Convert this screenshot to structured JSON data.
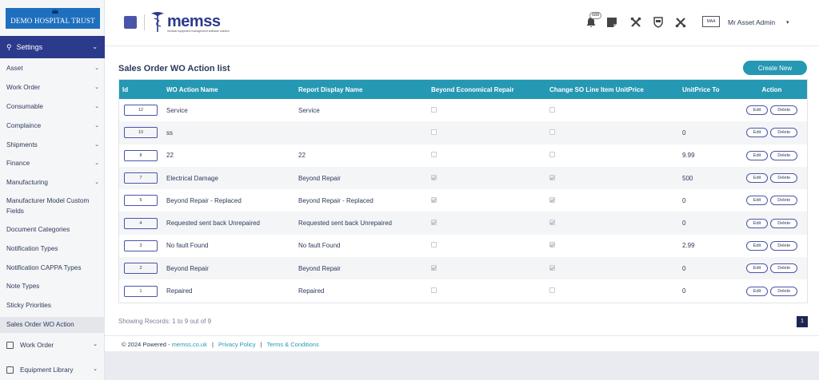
{
  "sidebar": {
    "logo_text": "DEMO HOSPITAL TRUST",
    "settings_label": "Settings",
    "items": [
      {
        "label": "Asset",
        "chevron": true
      },
      {
        "label": "Work Order",
        "chevron": true
      },
      {
        "label": "Consumable",
        "chevron": true
      },
      {
        "label": "Complaince",
        "chevron": true
      },
      {
        "label": "Shipments",
        "chevron": true
      },
      {
        "label": "Finance",
        "chevron": true
      },
      {
        "label": "Manufacturing",
        "chevron": true
      },
      {
        "label": "Manufacturer Model Custom Fields",
        "chevron": false
      },
      {
        "label": "Document Categories",
        "chevron": false
      },
      {
        "label": "Notification Types",
        "chevron": false
      },
      {
        "label": "Notification CAPPA Types",
        "chevron": false
      },
      {
        "label": "Note Types",
        "chevron": false
      },
      {
        "label": "Sticky Priorities",
        "chevron": false
      },
      {
        "label": "Sales Order WO Action",
        "chevron": false,
        "active": true
      }
    ],
    "bottom_items": [
      {
        "label": "Work Order"
      },
      {
        "label": "Equipment Library"
      }
    ]
  },
  "topbar": {
    "brand": "memss",
    "tagline": "medical equipment management software solution",
    "notification_count": "688",
    "user_name": "Mr Asset Admin",
    "avatar_text": "MAA"
  },
  "page": {
    "title": "Sales Order WO Action list",
    "create_label": "Create New",
    "columns": [
      "Id",
      "WO Action Name",
      "Report Display Name",
      "Beyond Economical Repair",
      "Change SO Line Item UnitPrice",
      "UnitPrice To",
      "Action"
    ],
    "rows": [
      {
        "id": "12",
        "name": "Service",
        "report": "Service",
        "ber": false,
        "change": false,
        "price": ""
      },
      {
        "id": "10",
        "name": "ss",
        "report": "",
        "ber": false,
        "change": false,
        "price": "0"
      },
      {
        "id": "8",
        "name": "22",
        "report": "22",
        "ber": false,
        "change": false,
        "price": "9.99"
      },
      {
        "id": "7",
        "name": "Electrical Damage",
        "report": "Beyond Repair",
        "ber": true,
        "change": true,
        "price": "500"
      },
      {
        "id": "5",
        "name": "Beyond Repair - Replaced",
        "report": "Beyond Repair - Replaced",
        "ber": true,
        "change": true,
        "price": "0"
      },
      {
        "id": "4",
        "name": "Requested sent back Unrepaired",
        "report": "Requested sent back Unrepaired",
        "ber": true,
        "change": true,
        "price": "0"
      },
      {
        "id": "3",
        "name": "No fault Found",
        "report": "No fault Found",
        "ber": false,
        "change": true,
        "price": "2.99"
      },
      {
        "id": "2",
        "name": "Beyond Repair",
        "report": "Beyond Repair",
        "ber": true,
        "change": true,
        "price": "0"
      },
      {
        "id": "1",
        "name": "Repaired",
        "report": "Repaired",
        "ber": false,
        "change": false,
        "price": "0"
      }
    ],
    "edit_label": "Edit",
    "delete_label": "Delete",
    "showing_text": "Showing Records: 1 to 9 out of 9",
    "current_page": "1"
  },
  "footer": {
    "copyright": "© 2024 Powered -",
    "link_site": "memss.co.uk",
    "link_privacy": "Privacy Policy",
    "link_terms": "Terms & Conditions"
  },
  "colors": {
    "primary": "#2c3a8c",
    "accent": "#2598b3",
    "logo_bg": "#1f6fbf"
  }
}
